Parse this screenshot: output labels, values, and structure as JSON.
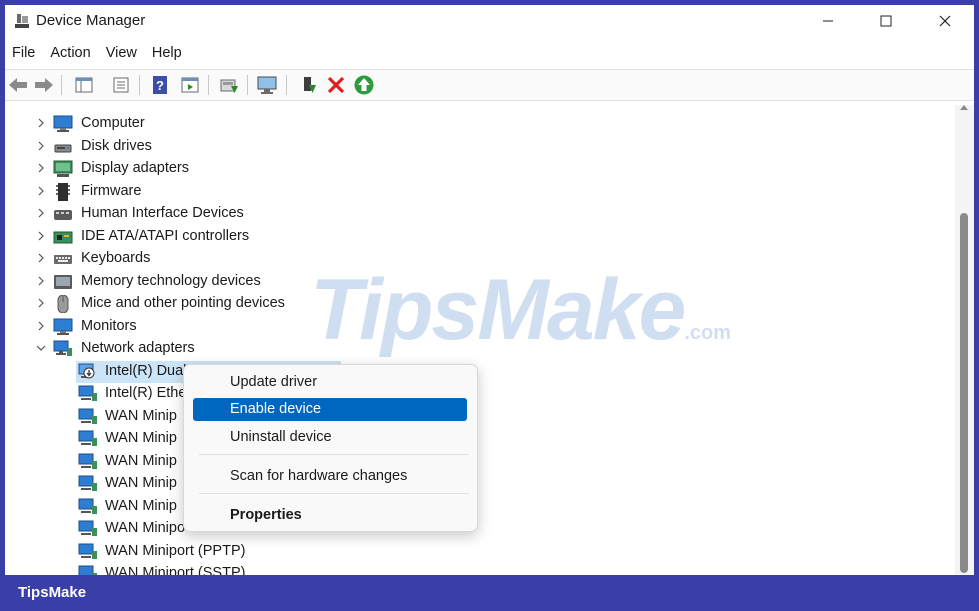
{
  "window": {
    "title": "Device Manager"
  },
  "menubar": {
    "items": [
      "File",
      "Action",
      "View",
      "Help"
    ]
  },
  "toolbar": {
    "buttons": [
      "back-icon",
      "forward-icon",
      "console-tree-icon",
      "properties-icon",
      "help-icon",
      "action-pane-icon",
      "update-driver-icon",
      "scan-hardware-icon",
      "enable-device-icon",
      "uninstall-icon",
      "add-legacy-icon"
    ]
  },
  "tree": {
    "categories": [
      {
        "label": "Computer",
        "icon": "computer-icon"
      },
      {
        "label": "Disk drives",
        "icon": "disk-drive-icon"
      },
      {
        "label": "Display adapters",
        "icon": "display-adapter-icon"
      },
      {
        "label": "Firmware",
        "icon": "firmware-icon"
      },
      {
        "label": "Human Interface Devices",
        "icon": "hid-icon"
      },
      {
        "label": "IDE ATA/ATAPI controllers",
        "icon": "ide-controller-icon"
      },
      {
        "label": "Keyboards",
        "icon": "keyboard-icon"
      },
      {
        "label": "Memory technology devices",
        "icon": "memory-icon"
      },
      {
        "label": "Mice and other pointing devices",
        "icon": "mouse-icon"
      },
      {
        "label": "Monitors",
        "icon": "monitor-icon"
      },
      {
        "label": "Network adapters",
        "icon": "network-adapter-icon",
        "expanded": true
      }
    ],
    "network_children": [
      {
        "label": "Intel(R) Dual",
        "disabled": true,
        "selected": true
      },
      {
        "label": "Intel(R) Ethe"
      },
      {
        "label": "WAN Minip"
      },
      {
        "label": "WAN Minip"
      },
      {
        "label": "WAN Minip"
      },
      {
        "label": "WAN Minip"
      },
      {
        "label": "WAN Minip"
      },
      {
        "label": "WAN Minipo"
      },
      {
        "label": "WAN Miniport (PPTP)"
      },
      {
        "label": "WAN Miniport (SSTP)"
      }
    ]
  },
  "context_menu": {
    "items": [
      {
        "label": "Update driver"
      },
      {
        "label": "Enable device",
        "highlighted": true
      },
      {
        "label": "Uninstall device"
      },
      {
        "label": "Scan for hardware changes"
      },
      {
        "label": "Properties",
        "bold": true
      }
    ]
  },
  "watermark": {
    "text": "TipsMake",
    "suffix": ".com"
  },
  "footer": {
    "brand": "TipsMake"
  },
  "colors": {
    "accent": "#0067c0",
    "frame": "#3a3fa8",
    "selection": "#cce4f7"
  }
}
